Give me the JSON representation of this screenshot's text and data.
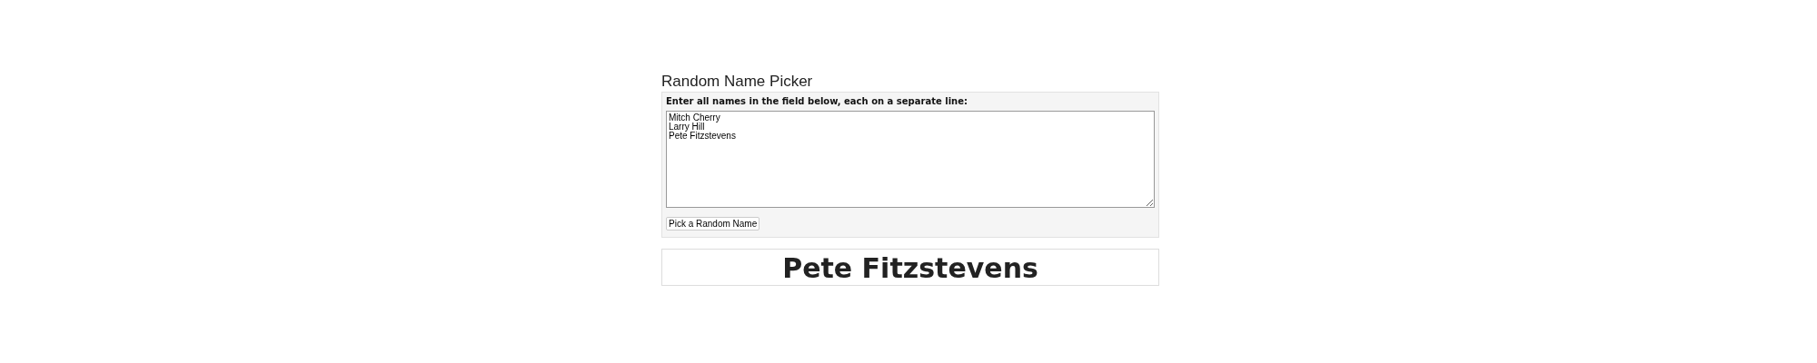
{
  "title": "Random Name Picker",
  "form": {
    "instruction": "Enter all names in the field below, each on a separate line:",
    "names_field": {
      "value": "Mitch Cherry\nLarry Hill\nPete Fitzstevens"
    },
    "button": "Pick a Random Name"
  },
  "result": "Pete Fitzstevens"
}
